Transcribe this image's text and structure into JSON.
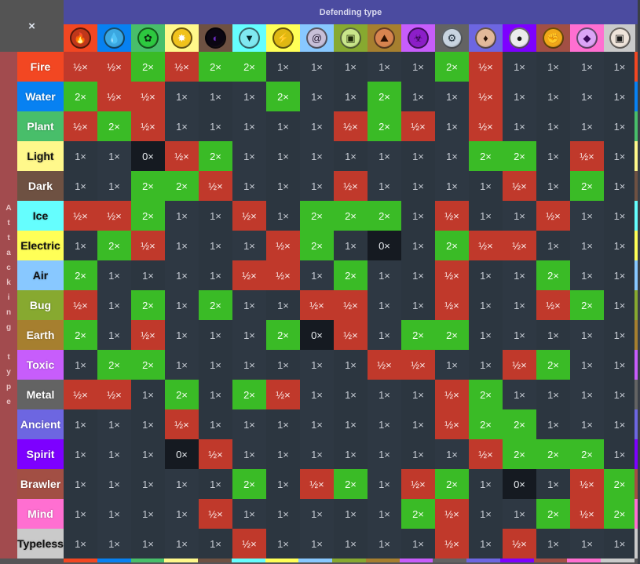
{
  "corner": {
    "close_label": "×"
  },
  "header": {
    "defending_label": "Defending type"
  },
  "attacking_label": [
    "A",
    "t",
    "t",
    "a",
    "c",
    "k",
    "i",
    "n",
    "g",
    " ",
    "t",
    "y",
    "p",
    "e"
  ],
  "types": [
    {
      "name": "Fire",
      "color": "#f24722",
      "label_color": "#ffffff",
      "icon": "flame-icon",
      "glyph": "🔥",
      "icon_bg": "#c0371a",
      "icon_fg": "#000000"
    },
    {
      "name": "Water",
      "color": "#0781f2",
      "label_color": "#ffffff",
      "icon": "water-drop-icon",
      "glyph": "💧",
      "icon_bg": "#3ba7e0",
      "icon_fg": "#000000"
    },
    {
      "name": "Plant",
      "color": "#48be6a",
      "label_color": "#ffffff",
      "icon": "flower-icon",
      "glyph": "✿",
      "icon_bg": "#2dc93f",
      "icon_fg": "#0a2a10"
    },
    {
      "name": "Light",
      "color": "#fff88b",
      "label_color": "#111111",
      "icon": "sparkle-icon",
      "glyph": "✸",
      "icon_bg": "#f1c21b",
      "icon_fg": "#ffffff"
    },
    {
      "name": "Dark",
      "color": "#6e5142",
      "label_color": "#ffffff",
      "icon": "dark-orb-icon",
      "glyph": "◐",
      "icon_bg": "#0b0612",
      "icon_fg": "#6a2bc0"
    },
    {
      "name": "Ice",
      "color": "#65fefe",
      "label_color": "#111111",
      "icon": "ice-peak-icon",
      "glyph": "▼",
      "icon_bg": "#7fe8f0",
      "icon_fg": "#06262a"
    },
    {
      "name": "Electric",
      "color": "#ffff57",
      "label_color": "#111111",
      "icon": "lightning-icon",
      "glyph": "⚡",
      "icon_bg": "#e0b812",
      "icon_fg": "#2a1a00"
    },
    {
      "name": "Air",
      "color": "#88c8ff",
      "label_color": "#111111",
      "icon": "swirl-icon",
      "glyph": "@",
      "icon_bg": "#c7bfd8",
      "icon_fg": "#2a2038"
    },
    {
      "name": "Bug",
      "color": "#87a930",
      "label_color": "#ffffff",
      "icon": "bug-icon",
      "glyph": "▣",
      "icon_bg": "#c9e68a",
      "icon_fg": "#1f2a08"
    },
    {
      "name": "Earth",
      "color": "#a67f2f",
      "label_color": "#ffffff",
      "icon": "rock-icon",
      "glyph": "⛰",
      "icon_bg": "#d7844f",
      "icon_fg": "#2a1000"
    },
    {
      "name": "Toxic",
      "color": "#c75dfb",
      "label_color": "#ffffff",
      "icon": "biohazard-icon",
      "glyph": "☣",
      "icon_bg": "#8c1ec8",
      "icon_fg": "#2a0540"
    },
    {
      "name": "Metal",
      "color": "#636363",
      "label_color": "#ffffff",
      "icon": "gear-icon",
      "glyph": "⚙",
      "icon_bg": "#c8d4e0",
      "icon_fg": "#1a2836"
    },
    {
      "name": "Ancient",
      "color": "#6d66e1",
      "label_color": "#ffffff",
      "icon": "ancient-icon",
      "glyph": "♦",
      "icon_bg": "#e2b99a",
      "icon_fg": "#2a1408"
    },
    {
      "name": "Spirit",
      "color": "#7d00ff",
      "label_color": "#ffffff",
      "icon": "spirit-icon",
      "glyph": "●",
      "icon_bg": "#ececec",
      "icon_fg": "#1a1a1a"
    },
    {
      "name": "Brawler",
      "color": "#a24f44",
      "label_color": "#ffffff",
      "icon": "fist-icon",
      "glyph": "✊",
      "icon_bg": "#f0a818",
      "icon_fg": "#2a0a00"
    },
    {
      "name": "Mind",
      "color": "#ff6fd1",
      "label_color": "#ffffff",
      "icon": "mind-icon",
      "glyph": "◆",
      "icon_bg": "#dba4f6",
      "icon_fg": "#3a0a5a"
    },
    {
      "name": "Typeless",
      "color": "#cacaca",
      "label_color": "#111111",
      "icon": "typeless-icon",
      "glyph": "▣",
      "icon_bg": "#efe4da",
      "icon_fg": "#1a1a1a"
    }
  ],
  "status_colors": {
    "half": "#c0392b",
    "double": "#3abb26",
    "zero": "#151a21",
    "neutral": "#2c3640"
  },
  "matrix": [
    [
      "½×",
      "½×",
      "2×",
      "½×",
      "2×",
      "2×",
      "1×",
      "1×",
      "1×",
      "1×",
      "1×",
      "2×",
      "½×",
      "1×",
      "1×",
      "1×",
      "1×"
    ],
    [
      "2×",
      "½×",
      "½×",
      "1×",
      "1×",
      "1×",
      "2×",
      "1×",
      "1×",
      "2×",
      "1×",
      "1×",
      "½×",
      "1×",
      "1×",
      "1×",
      "1×"
    ],
    [
      "½×",
      "2×",
      "½×",
      "1×",
      "1×",
      "1×",
      "1×",
      "1×",
      "½×",
      "2×",
      "½×",
      "1×",
      "½×",
      "1×",
      "1×",
      "1×",
      "1×"
    ],
    [
      "1×",
      "1×",
      "0×",
      "½×",
      "2×",
      "1×",
      "1×",
      "1×",
      "1×",
      "1×",
      "1×",
      "1×",
      "2×",
      "2×",
      "1×",
      "½×",
      "1×"
    ],
    [
      "1×",
      "1×",
      "2×",
      "2×",
      "½×",
      "1×",
      "1×",
      "1×",
      "½×",
      "1×",
      "1×",
      "1×",
      "1×",
      "½×",
      "1×",
      "2×",
      "1×"
    ],
    [
      "½×",
      "½×",
      "2×",
      "1×",
      "1×",
      "½×",
      "1×",
      "2×",
      "2×",
      "2×",
      "1×",
      "½×",
      "1×",
      "1×",
      "½×",
      "1×",
      "1×"
    ],
    [
      "1×",
      "2×",
      "½×",
      "1×",
      "1×",
      "1×",
      "½×",
      "2×",
      "1×",
      "0×",
      "1×",
      "2×",
      "½×",
      "½×",
      "1×",
      "1×",
      "1×"
    ],
    [
      "2×",
      "1×",
      "1×",
      "1×",
      "1×",
      "½×",
      "½×",
      "1×",
      "2×",
      "1×",
      "1×",
      "½×",
      "1×",
      "1×",
      "2×",
      "1×",
      "1×"
    ],
    [
      "½×",
      "1×",
      "2×",
      "1×",
      "2×",
      "1×",
      "1×",
      "½×",
      "½×",
      "1×",
      "1×",
      "½×",
      "1×",
      "1×",
      "½×",
      "2×",
      "1×"
    ],
    [
      "2×",
      "1×",
      "½×",
      "1×",
      "1×",
      "1×",
      "2×",
      "0×",
      "½×",
      "1×",
      "2×",
      "2×",
      "1×",
      "1×",
      "1×",
      "1×",
      "1×"
    ],
    [
      "1×",
      "2×",
      "2×",
      "1×",
      "1×",
      "1×",
      "1×",
      "1×",
      "1×",
      "½×",
      "½×",
      "1×",
      "1×",
      "½×",
      "2×",
      "1×",
      "1×"
    ],
    [
      "½×",
      "½×",
      "1×",
      "2×",
      "1×",
      "2×",
      "½×",
      "1×",
      "1×",
      "1×",
      "1×",
      "½×",
      "2×",
      "1×",
      "1×",
      "1×",
      "1×"
    ],
    [
      "1×",
      "1×",
      "1×",
      "½×",
      "1×",
      "1×",
      "1×",
      "1×",
      "1×",
      "1×",
      "1×",
      "½×",
      "2×",
      "2×",
      "1×",
      "1×",
      "1×"
    ],
    [
      "1×",
      "1×",
      "1×",
      "0×",
      "½×",
      "1×",
      "1×",
      "1×",
      "1×",
      "1×",
      "1×",
      "1×",
      "½×",
      "2×",
      "2×",
      "2×",
      "1×"
    ],
    [
      "1×",
      "1×",
      "1×",
      "1×",
      "1×",
      "2×",
      "1×",
      "½×",
      "2×",
      "1×",
      "½×",
      "2×",
      "1×",
      "0×",
      "1×",
      "½×",
      "2×"
    ],
    [
      "1×",
      "1×",
      "1×",
      "1×",
      "½×",
      "1×",
      "1×",
      "1×",
      "1×",
      "1×",
      "2×",
      "½×",
      "1×",
      "1×",
      "2×",
      "½×",
      "2×"
    ],
    [
      "1×",
      "1×",
      "1×",
      "1×",
      "1×",
      "½×",
      "1×",
      "1×",
      "1×",
      "1×",
      "1×",
      "½×",
      "1×",
      "½×",
      "1×",
      "1×",
      "1×"
    ]
  ]
}
